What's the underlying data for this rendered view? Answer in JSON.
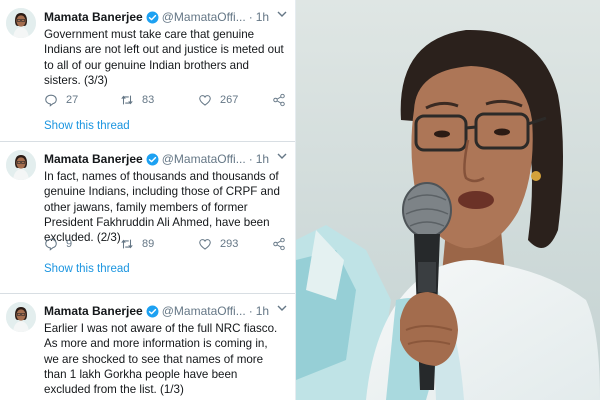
{
  "tweets": [
    {
      "author": "Mamata Banerjee",
      "handle": "@MamataOffi...",
      "separator": "·",
      "time": "1h",
      "text": "Government must take care that genuine Indians are not left out and justice is meted out to all of our genuine Indian brothers and sisters. (3/3)",
      "replies": "27",
      "retweets": "83",
      "likes": "267",
      "thread_link": "Show this thread"
    },
    {
      "author": "Mamata Banerjee",
      "handle": "@MamataOffi...",
      "separator": "·",
      "time": "1h",
      "text": "In fact, names of thousands and thousands of genuine Indians, including those of CRPF and other jawans, family members of former President Fakhruddin Ali Ahmed, have been excluded.  (2/3)",
      "replies": "9",
      "retweets": "89",
      "likes": "293",
      "thread_link": "Show this thread"
    },
    {
      "author": "Mamata Banerjee",
      "handle": "@MamataOffi...",
      "separator": "·",
      "time": "1h",
      "text": "Earlier I was not aware of the full NRC fiasco. As more and more information is coming in, we are shocked to see that names of more than 1 lakh Gorkha people have been excluded from the list.  (1/3)"
    }
  ],
  "colors": {
    "link": "#1b95e0",
    "verified": "#1da1f2",
    "secondary": "#657786"
  },
  "icons": [
    "verified-badge-icon",
    "chevron-down-icon",
    "reply-icon",
    "retweet-icon",
    "like-icon",
    "share-icon"
  ]
}
